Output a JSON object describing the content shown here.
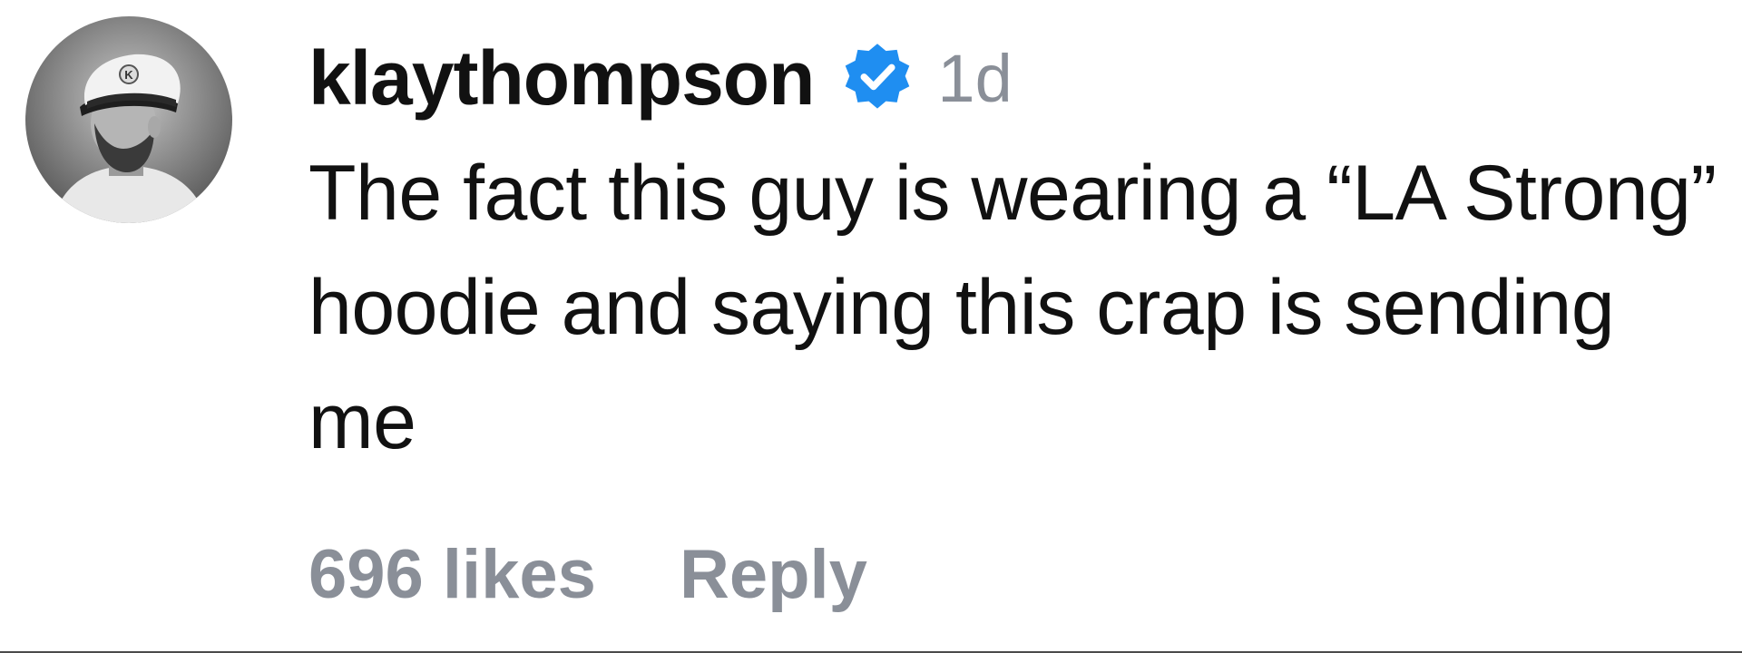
{
  "comment": {
    "username": "klaythompson",
    "verified": true,
    "verified_color": "#1f8ef1",
    "timestamp": "1d",
    "text": "The fact this guy is wearing a “LA Strong” hoodie and saying this crap is sending me",
    "avatar_icon": "profile-photo-captain-hat",
    "avatar_hat_letter": "K",
    "likes_label": "696 likes",
    "reply_label": "Reply"
  },
  "colors": {
    "text_primary": "#111111",
    "text_secondary": "#8a8f98",
    "background": "#ffffff"
  }
}
